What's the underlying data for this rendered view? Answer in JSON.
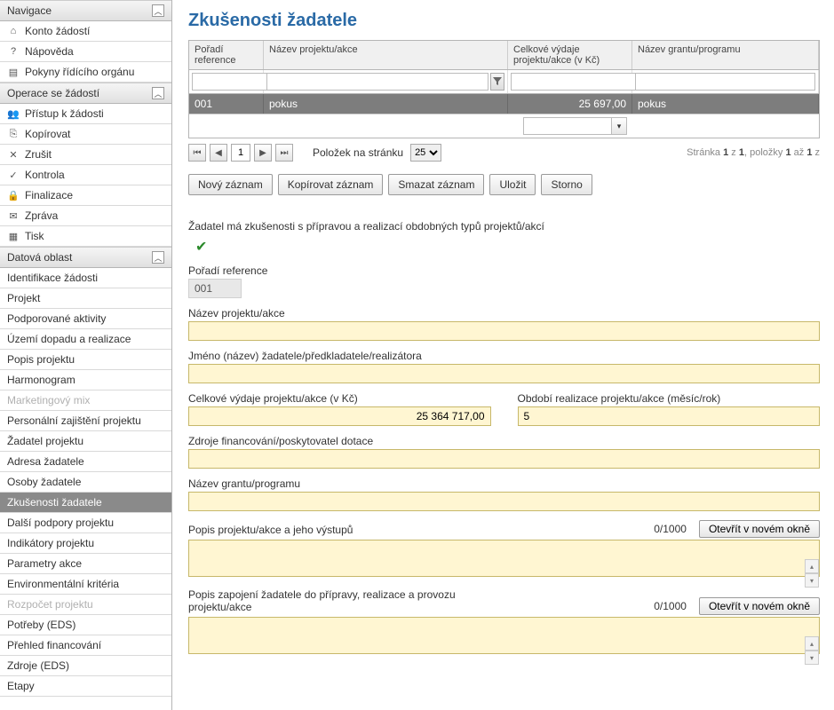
{
  "sidebar": {
    "groups": [
      {
        "title": "Navigace",
        "items": [
          {
            "icon": "⌂",
            "label": "Konto žádostí"
          },
          {
            "icon": "?",
            "label": "Nápověda"
          },
          {
            "icon": "▤",
            "label": "Pokyny řídícího orgánu"
          }
        ]
      },
      {
        "title": "Operace se žádostí",
        "items": [
          {
            "icon": "👥",
            "label": "Přístup k žádosti"
          },
          {
            "icon": "⎘",
            "label": "Kopírovat"
          },
          {
            "icon": "✕",
            "label": "Zrušit"
          },
          {
            "icon": "✓",
            "label": "Kontrola"
          },
          {
            "icon": "🔒",
            "label": "Finalizace"
          },
          {
            "icon": "✉",
            "label": "Zpráva"
          },
          {
            "icon": "▦",
            "label": "Tisk"
          }
        ]
      },
      {
        "title": "Datová oblast",
        "items": [
          {
            "label": "Identifikace žádosti"
          },
          {
            "label": "Projekt"
          },
          {
            "label": "Podporované aktivity"
          },
          {
            "label": "Území dopadu a realizace"
          },
          {
            "label": "Popis projektu"
          },
          {
            "label": "Harmonogram"
          },
          {
            "label": "Marketingový mix",
            "disabled": true
          },
          {
            "label": "Personální zajištění projektu"
          },
          {
            "label": "Žadatel projektu"
          },
          {
            "label": "Adresa žadatele"
          },
          {
            "label": "Osoby žadatele"
          },
          {
            "label": "Zkušenosti žadatele",
            "active": true
          },
          {
            "label": "Další podpory projektu"
          },
          {
            "label": "Indikátory projektu"
          },
          {
            "label": "Parametry akce"
          },
          {
            "label": "Environmentální kritéria"
          },
          {
            "label": "Rozpočet projektu",
            "disabled": true
          },
          {
            "label": "Potřeby (EDS)"
          },
          {
            "label": "Přehled financování"
          },
          {
            "label": "Zdroje (EDS)"
          },
          {
            "label": "Etapy"
          }
        ]
      }
    ]
  },
  "page": {
    "title": "Zkušenosti žadatele"
  },
  "grid": {
    "headers": [
      "Pořadí reference",
      "Název projektu/akce",
      "Celkové výdaje projektu/akce (v Kč)",
      "Název grantu/programu"
    ],
    "row": {
      "ref": "001",
      "name": "pokus",
      "total": "25 697,00",
      "grant": "pokus"
    }
  },
  "pager": {
    "page": "1",
    "per_page_label": "Položek na stránku",
    "per_page": "25",
    "info_prefix": "Stránka ",
    "info_mid": " z ",
    "info_suffix": ", položky ",
    "info_to": " až ",
    "p1": "1",
    "p2": "1",
    "i1": "1",
    "i2": "1",
    "iz": "z"
  },
  "toolbar": {
    "new": "Nový záznam",
    "copy": "Kopírovat záznam",
    "del": "Smazat záznam",
    "save": "Uložit",
    "cancel": "Storno"
  },
  "form": {
    "has_exp_label": "Žadatel má zkušenosti s přípravou a realizací obdobných typů projektů/akcí",
    "ref_label": "Pořadí reference",
    "ref_value": "001",
    "name_label": "Název projektu/akce",
    "name_value": "",
    "applicant_label": "Jméno (název) žadatele/předkladatele/realizátora",
    "applicant_value": "",
    "total_label": "Celkové výdaje projektu/akce (v Kč)",
    "total_value": "25 364 717,00",
    "period_label": "Období realizace projektu/akce (měsíc/rok)",
    "period_value": "5",
    "source_label": "Zdroje financování/poskytovatel dotace",
    "source_value": "",
    "grant_label": "Název grantu/programu",
    "grant_value": "",
    "desc_label": "Popis projektu/akce a jeho výstupů",
    "desc_counter": "0/1000",
    "open_btn": "Otevřít v novém okně",
    "involve_label": "Popis zapojení žadatele do přípravy, realizace a provozu projektu/akce",
    "involve_counter": "0/1000"
  }
}
